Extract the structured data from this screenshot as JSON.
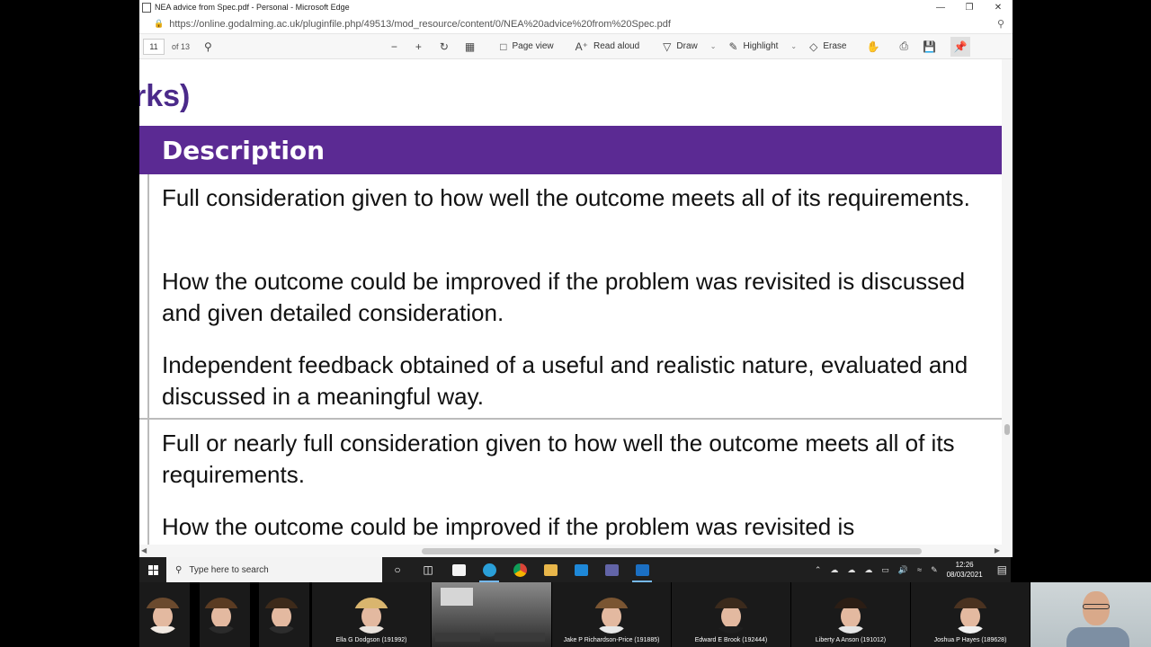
{
  "window": {
    "title": "NEA advice from Spec.pdf - Personal - Microsoft Edge",
    "url": "https://online.godalming.ac.uk/pluginfile.php/49513/mod_resource/content/0/NEA%20advice%20from%20Spec.pdf"
  },
  "pdf_toolbar": {
    "page_current": "11",
    "page_total": "of 13",
    "page_view": "Page view",
    "read_aloud": "Read aloud",
    "draw": "Draw",
    "highlight": "Highlight",
    "erase": "Erase"
  },
  "document": {
    "partial_heading": "rks)",
    "table_header": "Description",
    "paragraphs": [
      "Full consideration given to how well the outcome meets all of its requirements.",
      "How the outcome could be improved if the problem was revisited is discussed and given detailed consideration.",
      "Independent feedback obtained of a useful and realistic nature, evaluated and discussed in a meaningful way.",
      "Full or nearly full consideration given to how well the outcome meets all of its requirements.",
      "How the outcome could be improved if the problem was revisited is"
    ]
  },
  "taskbar": {
    "search_placeholder": "Type here to search",
    "time": "12:26",
    "date": "08/03/2021"
  },
  "participants": [
    {
      "name": "Ella G Dodgson (191992)"
    },
    {
      "name": "Jake P Richardson-Price (191885)"
    },
    {
      "name": "Edward E Brook (192444)"
    },
    {
      "name": "Liberty A Anson (191012)"
    },
    {
      "name": "Joshua P Hayes (189628)"
    }
  ]
}
